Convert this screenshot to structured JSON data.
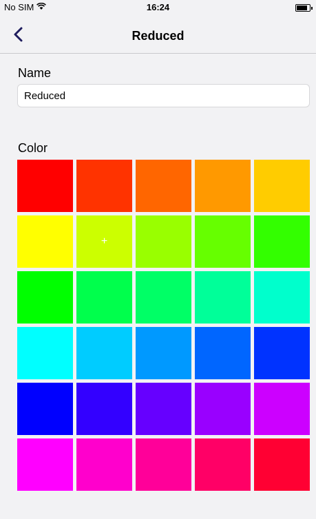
{
  "status": {
    "carrier": "No SIM",
    "time": "16:24"
  },
  "nav": {
    "title": "Reduced"
  },
  "name_section": {
    "label": "Name",
    "value": "Reduced"
  },
  "color_section": {
    "label": "Color",
    "selected_index": 6,
    "selected_glyph": "+",
    "swatches": [
      "#ff0000",
      "#ff3300",
      "#ff6600",
      "#ff9900",
      "#ffcc00",
      "#ffff00",
      "#ccff00",
      "#99ff00",
      "#66ff00",
      "#33ff00",
      "#00ff00",
      "#00ff4c",
      "#00ff66",
      "#00ff99",
      "#00ffcc",
      "#00ffff",
      "#00ccff",
      "#0099ff",
      "#0066ff",
      "#0033ff",
      "#0000ff",
      "#3300ff",
      "#6600ff",
      "#9900ff",
      "#cc00ff",
      "#ff00ff",
      "#ff00cc",
      "#ff0099",
      "#ff0066",
      "#ff0033"
    ]
  }
}
